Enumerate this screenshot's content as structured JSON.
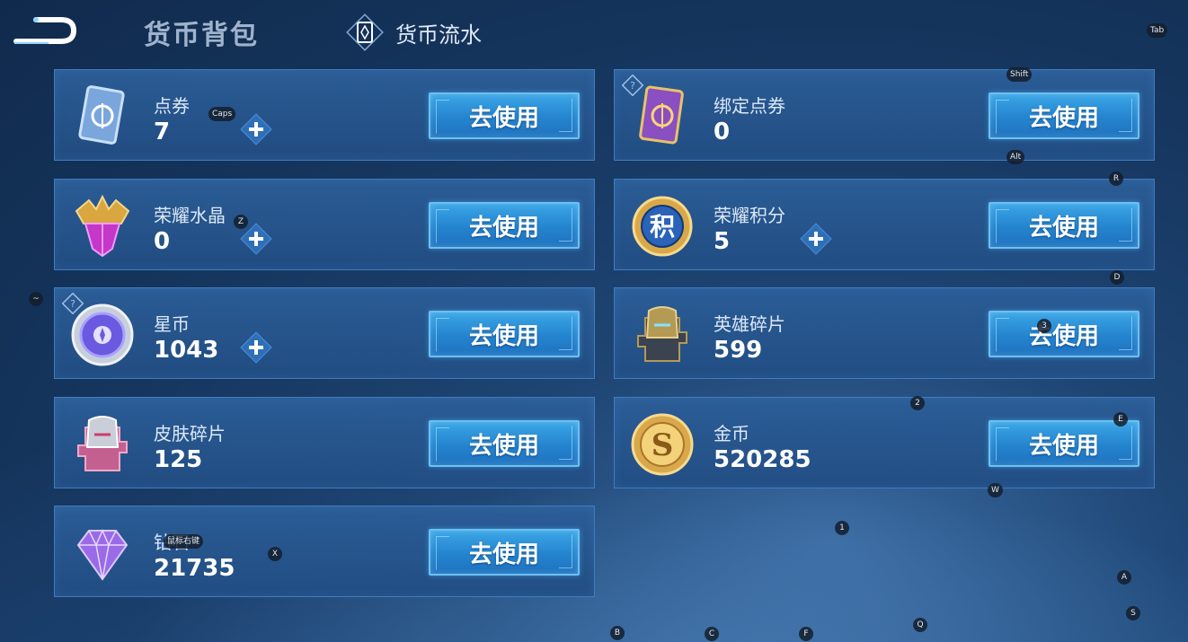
{
  "header": {
    "title": "货币背包",
    "flow_tab": "货币流水"
  },
  "use_label": "去使用",
  "currencies": [
    {
      "name": "点券",
      "amount": "7",
      "icon": "ticket-icon",
      "color": "#7aa6dc"
    },
    {
      "name": "绑定点券",
      "amount": "0",
      "icon": "bound-ticket-icon",
      "color": "#8a4fc0"
    },
    {
      "name": "荣耀水晶",
      "amount": "0",
      "icon": "crystal-icon",
      "color": "#c437c8"
    },
    {
      "name": "荣耀积分",
      "amount": "5",
      "icon": "honor-points-icon",
      "color": "#2a63b8"
    },
    {
      "name": "星币",
      "amount": "1043",
      "icon": "star-coin-icon",
      "color": "#6a5ae0"
    },
    {
      "name": "英雄碎片",
      "amount": "599",
      "icon": "hero-fragment-icon",
      "color": "#b59a55"
    },
    {
      "name": "皮肤碎片",
      "amount": "125",
      "icon": "skin-fragment-icon",
      "color": "#c46090"
    },
    {
      "name": "金币",
      "amount": "520285",
      "icon": "gold-coin-icon",
      "color": "#d8a84a"
    },
    {
      "name": "钻石",
      "amount": "21735",
      "icon": "diamond-icon",
      "color": "#9a6ae8"
    }
  ],
  "key_hints": {
    "tab": "Tab",
    "shift": "Shift",
    "caps": "Caps",
    "alt": "Alt",
    "r": "R",
    "z": "Z",
    "d": "D",
    "tilde": "~",
    "three": "3",
    "two": "2",
    "e": "E",
    "w": "W",
    "one": "1",
    "x": "X",
    "combo": "鼠标右键",
    "a": "A",
    "s": "S",
    "b": "B",
    "c": "C",
    "f": "F",
    "q": "Q"
  }
}
